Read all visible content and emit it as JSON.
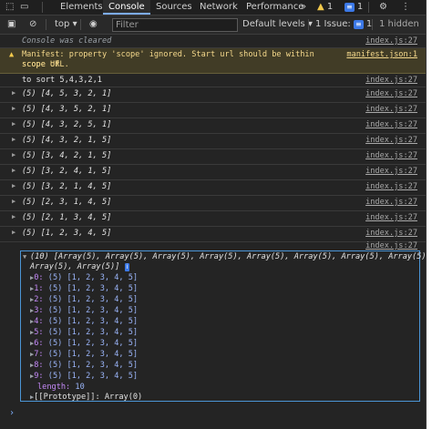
{
  "tabbar": {
    "tabs": [
      "Elements",
      "Console",
      "Sources",
      "Network",
      "Performance"
    ],
    "more": "»",
    "warning_count": "1",
    "issue_count": "1"
  },
  "toolbar": {
    "context": "top",
    "filter_placeholder": "Filter",
    "levels": "Default levels",
    "issues_label": "1 Issue:",
    "issues_count": "1",
    "hidden": "1 hidden"
  },
  "console": {
    "cleared": "Console was cleared",
    "cleared_src": "index.js:27",
    "warning_text": "Manifest: property 'scope' ignored. Start url should be within scope of ",
    "warning_link": "manifest.json:1",
    "warning_text2": "scope URL.",
    "log_text": "to sort 5,4,3,2,1",
    "log_src": "index.js:27",
    "arrays": [
      {
        "text": "(5) [4, 5, 3, 2, 1]",
        "src": "index.js:27"
      },
      {
        "text": "(5) [4, 3, 5, 2, 1]",
        "src": "index.js:27"
      },
      {
        "text": "(5) [4, 3, 2, 5, 1]",
        "src": "index.js:27"
      },
      {
        "text": "(5) [4, 3, 2, 1, 5]",
        "src": "index.js:27"
      },
      {
        "text": "(5) [3, 4, 2, 1, 5]",
        "src": "index.js:27"
      },
      {
        "text": "(5) [3, 2, 4, 1, 5]",
        "src": "index.js:27"
      },
      {
        "text": "(5) [3, 2, 1, 4, 5]",
        "src": "index.js:27"
      },
      {
        "text": "(5) [2, 3, 1, 4, 5]",
        "src": "index.js:27"
      },
      {
        "text": "(5) [2, 1, 3, 4, 5]",
        "src": "index.js:27"
      },
      {
        "text": "(5) [1, 2, 3, 4, 5]",
        "src": "index.js:27"
      }
    ],
    "final_src": "index.js:27",
    "expanded": {
      "header1": "(10) [Array(5), Array(5), Array(5), Array(5), Array(5), Array(5), Array(5), Array(5), Array(5),",
      "header2": "Array(5), Array(5)]",
      "entries": [
        {
          "key": "0",
          "value": "(5) [1, 2, 3, 4, 5]"
        },
        {
          "key": "1",
          "value": "(5) [1, 2, 3, 4, 5]"
        },
        {
          "key": "2",
          "value": "(5) [1, 2, 3, 4, 5]"
        },
        {
          "key": "3",
          "value": "(5) [1, 2, 3, 4, 5]"
        },
        {
          "key": "4",
          "value": "(5) [1, 2, 3, 4, 5]"
        },
        {
          "key": "5",
          "value": "(5) [1, 2, 3, 4, 5]"
        },
        {
          "key": "6",
          "value": "(5) [1, 2, 3, 4, 5]"
        },
        {
          "key": "7",
          "value": "(5) [1, 2, 3, 4, 5]"
        },
        {
          "key": "8",
          "value": "(5) [1, 2, 3, 4, 5]"
        },
        {
          "key": "9",
          "value": "(5) [1, 2, 3, 4, 5]"
        }
      ],
      "length_label": "length:",
      "length_value": "10",
      "prototype_label": "[[Prototype]]:",
      "prototype_value": "Array(0)"
    },
    "prompt": "›"
  }
}
